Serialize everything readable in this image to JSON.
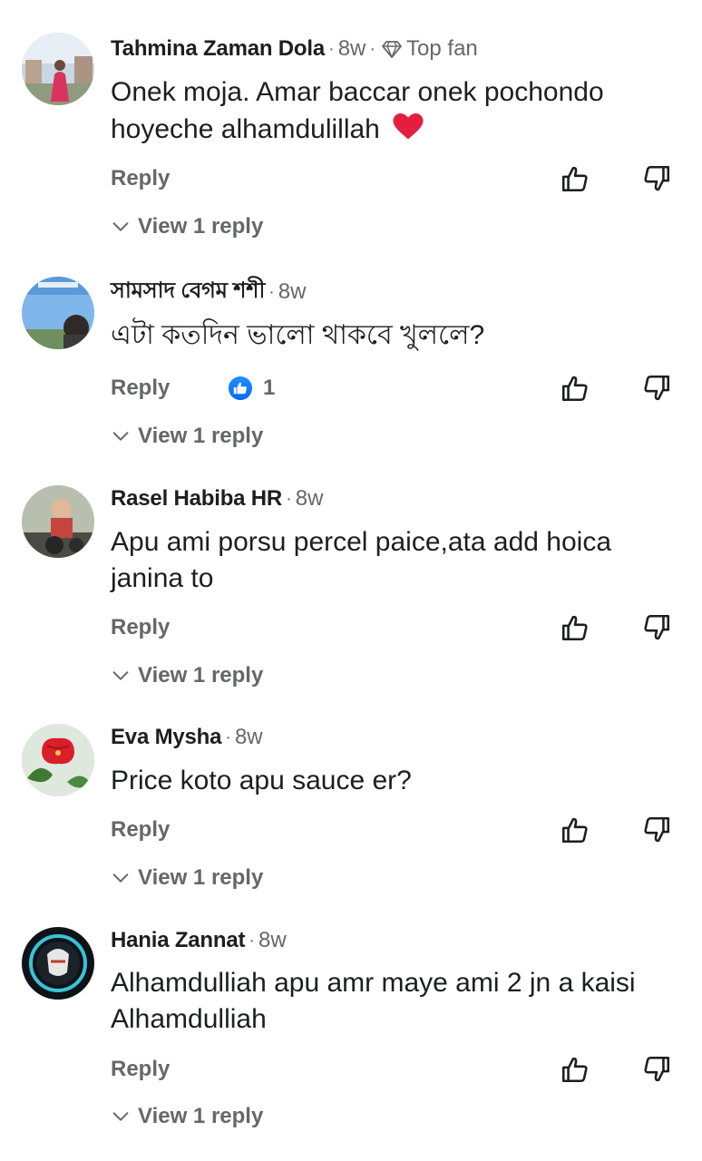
{
  "labels": {
    "reply": "Reply",
    "view_replies": "View 1 reply"
  },
  "colors": {
    "accent": "#0866ff",
    "secondary_text": "#65676b",
    "primary_text": "#1c1e21",
    "heart": "#e41e3f"
  },
  "comments": [
    {
      "author": "Tahmina Zaman Dola",
      "time": "8w",
      "badge": "Top fan",
      "badge_icon": "diamond-icon",
      "text": "Onek moja. Amar baccar onek pochondo hoyeche alhamdulillah",
      "emoji": "❤️",
      "avatar_icon": "profile-photo-woman"
    },
    {
      "author": "সামসাদ বেগম শশী",
      "time": "8w",
      "text": "এটা কতদিন ভালো থাকবে খুললে?",
      "reaction_count": "1",
      "reaction_icon": "like-icon",
      "avatar_icon": "profile-photo-sky"
    },
    {
      "author": "Rasel Habiba HR",
      "time": "8w",
      "text": "Apu ami porsu percel paice,ata add hoica janina to",
      "avatar_icon": "profile-photo-child"
    },
    {
      "author": "Eva Mysha",
      "time": "8w",
      "text": "Price koto apu sauce er?",
      "avatar_icon": "profile-photo-flower"
    },
    {
      "author": "Hania Zannat",
      "time": "8w",
      "text": "Alhamdulliah apu amr maye ami 2 jn a kaisi Alhamdulliah",
      "avatar_icon": "profile-photo-logo"
    }
  ]
}
